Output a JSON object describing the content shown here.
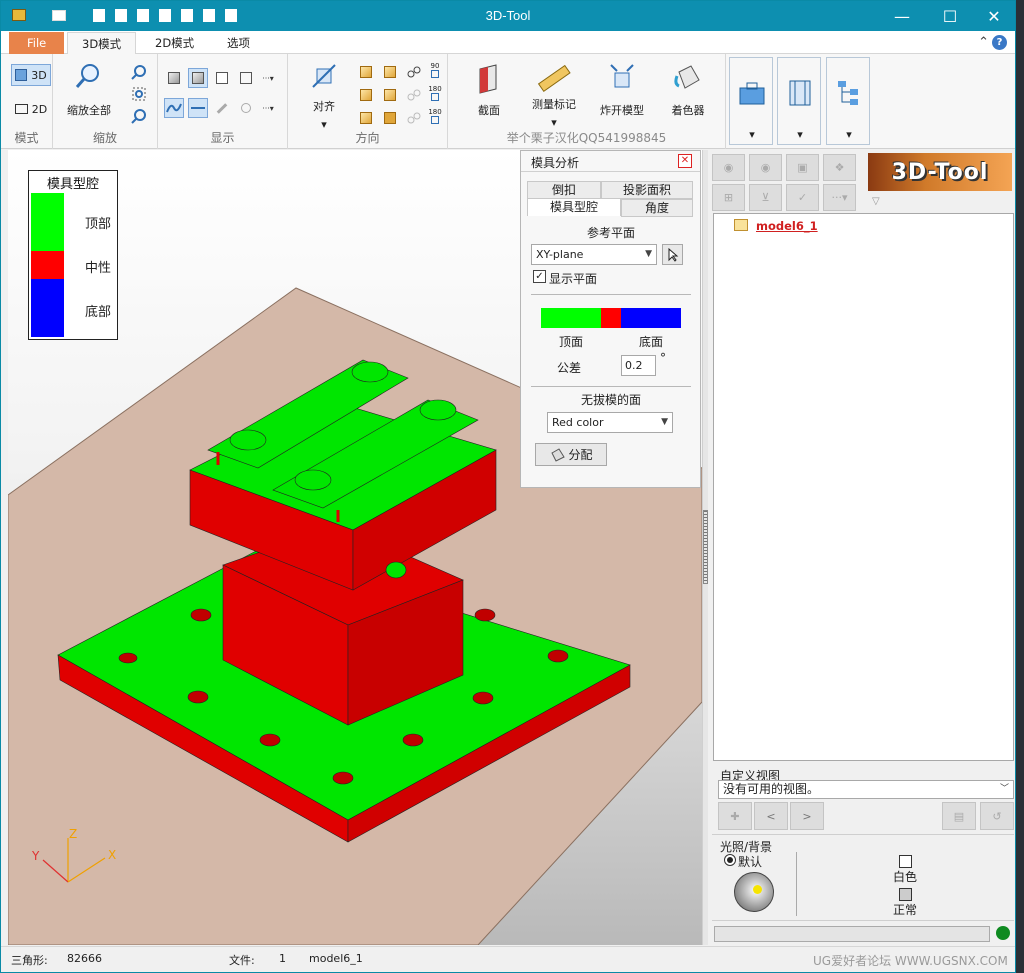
{
  "window": {
    "title": "3D-Tool"
  },
  "tabs": {
    "file": "File",
    "mode3d": "3D模式",
    "mode2d": "2D模式",
    "options": "选项"
  },
  "ribbon": {
    "mode": {
      "label": "模式",
      "btn3d": "3D",
      "btn2d": "2D"
    },
    "zoom": {
      "label": "缩放",
      "zoom_all": "缩放全部"
    },
    "display": {
      "label": "显示"
    },
    "direction": {
      "label": "方向",
      "align": "对齐",
      "rot_values": [
        "90",
        "180",
        "180"
      ]
    },
    "tools": {
      "section": "截面",
      "measure": "测量标记",
      "explode": "炸开模型",
      "color": "着色器",
      "watermark": "举个栗子汉化QQ541998845"
    }
  },
  "legend": {
    "title": "模具型腔",
    "items": [
      {
        "label": "顶部",
        "color": "#00ff00"
      },
      {
        "label": "中性",
        "color": "#ff0000"
      },
      {
        "label": "底部",
        "color": "#0000ff"
      }
    ]
  },
  "mold_panel": {
    "title": "模具分析",
    "tabs": [
      "倒扣",
      "投影面积",
      "模具型腔",
      "角度"
    ],
    "ref_plane_label": "参考平面",
    "ref_plane_value": "XY-plane",
    "show_plane": "显示平面",
    "top_label": "顶面",
    "bottom_label": "底面",
    "tolerance_label": "公差",
    "tolerance_value": "0.2",
    "degree": "°",
    "no_draft_label": "无拔模的面",
    "no_draft_value": "Red color",
    "assign_button": "分配"
  },
  "tree": {
    "item": "model6_1"
  },
  "custom_view": {
    "label": "自定义视图",
    "value": "没有可用的视图。"
  },
  "lighting": {
    "label": "光照/背景",
    "default": "默认",
    "white": "白色",
    "normal": "正常"
  },
  "axes": {
    "x": "X",
    "y": "Y",
    "z": "Z"
  },
  "status": {
    "tri_label": "三角形:",
    "tri_value": "82666",
    "file_label": "文件:",
    "file_count": "1",
    "file_name": "model6_1",
    "watermark": "UG爱好者论坛 WWW.UGSNX.COM"
  }
}
